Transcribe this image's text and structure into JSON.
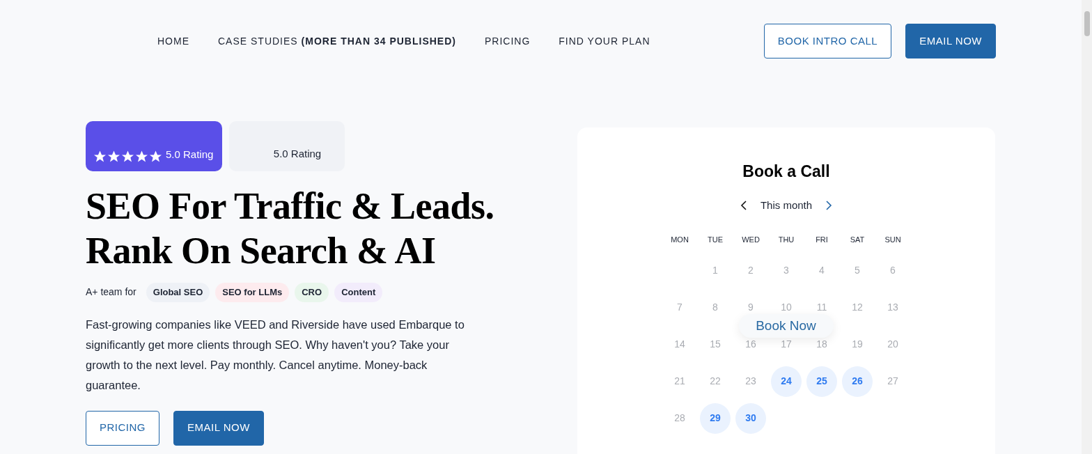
{
  "nav": {
    "links": [
      {
        "label": "HOME"
      },
      {
        "label": "CASE STUDIES **(MORE THAN 34 PUBLISHED)**"
      },
      {
        "label": "PRICING"
      },
      {
        "label": "FIND YOUR PLAN"
      }
    ],
    "buttons": [
      {
        "label": "BOOK INTRO CALL",
        "kind": "outline"
      },
      {
        "label": "EMAIL NOW",
        "kind": "solid"
      }
    ]
  },
  "ratings": [
    {
      "kind": "stars",
      "stars": 5,
      "label": "5.0 Rating"
    },
    {
      "kind": "plain",
      "label": "5.0 Rating"
    }
  ],
  "headline": [
    "SEO For Traffic & Leads.",
    "Rank On Search & AI"
  ],
  "team": {
    "label": "A+ team for",
    "tags": [
      {
        "label": "Global SEO",
        "color": "#eef1f6"
      },
      {
        "label": "SEO for LLMs",
        "color": "#fdebee"
      },
      {
        "label": "CRO",
        "color": "#e9f6ec"
      },
      {
        "label": "Content",
        "color": "#f2ecfb"
      }
    ]
  },
  "description": "Fast-growing companies like VEED and Riverside have used Embarque to significantly get more clients through SEO. Why haven't you? Take your growth to the next level. Pay monthly. Cancel anytime. Money-back guarantee.",
  "cta": [
    {
      "label": "PRICING",
      "kind": "outline"
    },
    {
      "label": "EMAIL NOW",
      "kind": "solid"
    }
  ],
  "booking": {
    "title": "Book a Call",
    "month": "This month",
    "weekdays": [
      "MON",
      "TUE",
      "WED",
      "THU",
      "FRI",
      "SAT",
      "SUN"
    ],
    "weeks": [
      [
        {
          "day": "1",
          "available": false
        },
        {
          "day": "2",
          "available": false
        },
        {
          "day": "3",
          "available": false
        },
        {
          "day": "4",
          "available": false
        },
        {
          "day": "5",
          "available": false
        },
        {
          "day": "6",
          "available": false
        }
      ],
      [
        {
          "day": "7",
          "available": false
        },
        {
          "day": "8",
          "available": false
        },
        {
          "day": "9",
          "available": false
        },
        {
          "day": "10",
          "available": false
        },
        {
          "day": "11",
          "available": false
        },
        {
          "day": "12",
          "available": false
        },
        {
          "day": "13",
          "available": false
        }
      ],
      [
        {
          "day": "14",
          "available": false
        },
        {
          "day": "15",
          "available": false
        },
        {
          "day": "16",
          "available": false
        },
        {
          "day": "17",
          "available": false
        },
        {
          "day": "18",
          "available": false
        },
        {
          "day": "19",
          "available": false
        },
        {
          "day": "20",
          "available": false
        }
      ],
      [
        {
          "day": "21",
          "available": false
        },
        {
          "day": "22",
          "available": false
        },
        {
          "day": "23",
          "available": false
        },
        {
          "day": "24",
          "available": true
        },
        {
          "day": "25",
          "available": true
        },
        {
          "day": "26",
          "available": true
        },
        {
          "day": "27",
          "available": false
        }
      ],
      [
        {
          "day": "28",
          "available": false
        },
        {
          "day": "29",
          "available": true
        },
        {
          "day": "30",
          "available": true
        }
      ]
    ],
    "overlay_button": "Book Now"
  }
}
